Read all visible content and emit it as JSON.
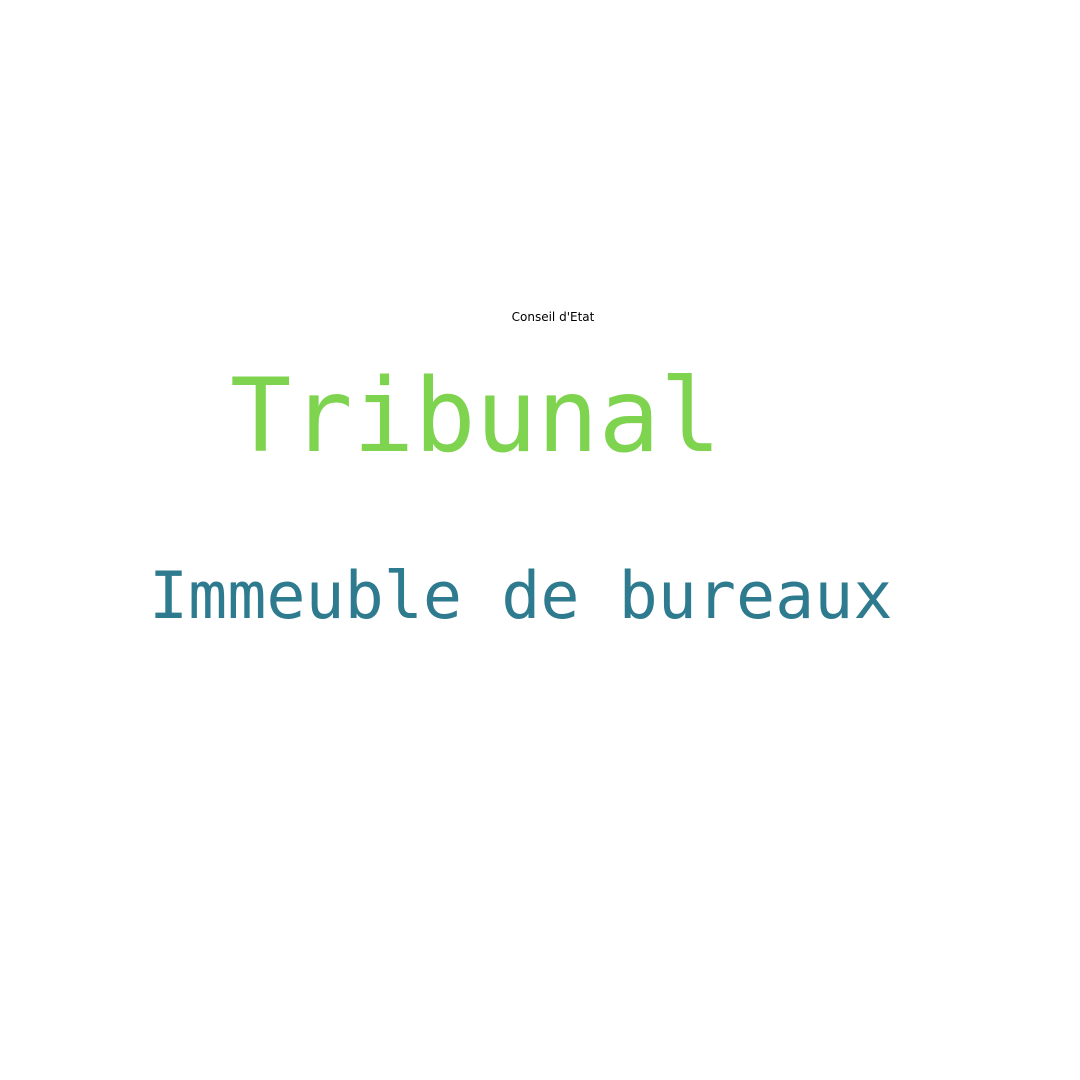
{
  "title": "Conseil d'Etat",
  "words": [
    {
      "text": "Tribunal",
      "color": "#7ed34f"
    },
    {
      "text": "Immeuble de bureaux",
      "color": "#2e7a8e"
    }
  ]
}
